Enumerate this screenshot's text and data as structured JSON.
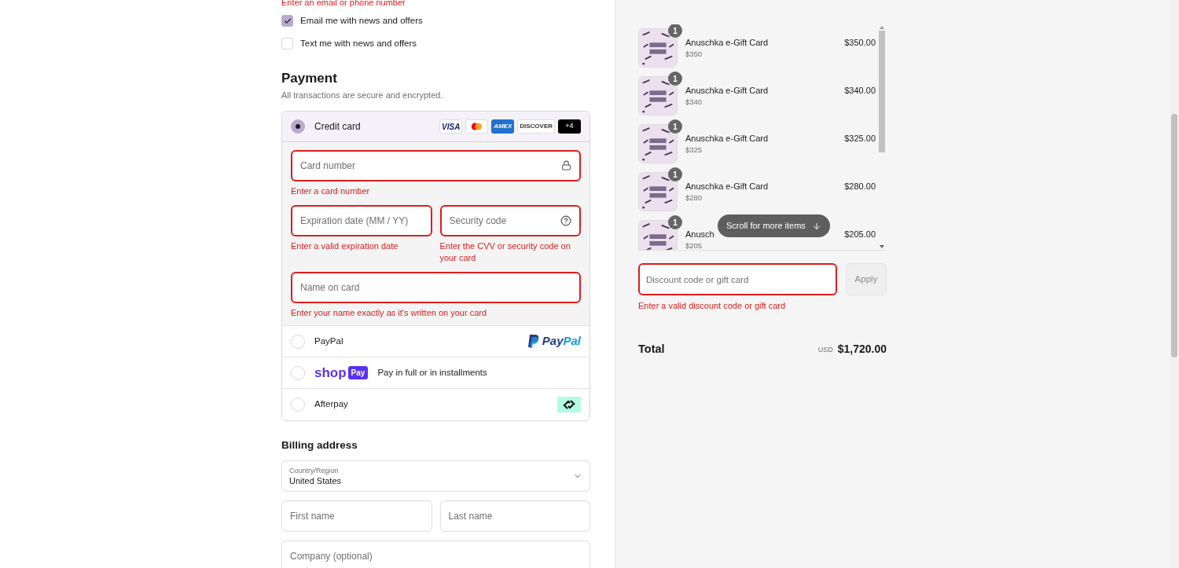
{
  "contact": {
    "error": "Enter an email or phone number",
    "options": [
      {
        "label": "Email me with news and offers",
        "checked": true
      },
      {
        "label": "Text me with news and offers",
        "checked": false
      }
    ]
  },
  "payment": {
    "title": "Payment",
    "subtitle": "All transactions are secure and encrypted.",
    "methods": [
      {
        "kind": "card",
        "label": "Credit card",
        "selected": true,
        "brands": [
          "VISA",
          "AMEX",
          "DISCOVER",
          "+4"
        ],
        "fields": [
          {
            "placeholder": "Card number",
            "error": "Enter a card number"
          },
          {
            "placeholder": "Expiration date (MM / YY)",
            "error": "Enter a valid expiration date"
          },
          {
            "placeholder": "Security code",
            "error": "Enter the CVV or security code on your card"
          },
          {
            "placeholder": "Name on card",
            "error": "Enter your name exactly as it's written on your card"
          }
        ]
      },
      {
        "kind": "paypal",
        "label": "PayPal",
        "selected": false,
        "logo": [
          "Pay",
          "Pal"
        ]
      },
      {
        "kind": "shoppay",
        "label": "Pay in full or in installments",
        "selected": false,
        "logo": [
          "shop",
          "Pay"
        ]
      },
      {
        "kind": "afterpay",
        "label": "Afterpay",
        "selected": false
      }
    ]
  },
  "billing": {
    "title": "Billing address",
    "country": {
      "label": "Country/Region",
      "value": "United States"
    },
    "fields": [
      {
        "placeholder": "First name"
      },
      {
        "placeholder": "Last name"
      },
      {
        "placeholder": "Company (optional)"
      }
    ]
  },
  "cart": {
    "items": [
      {
        "title": "Anuschka e-Gift Card",
        "variant": "$350",
        "price": "$350.00",
        "quantity": "1"
      },
      {
        "title": "Anuschka e-Gift Card",
        "variant": "$340",
        "price": "$340.00",
        "quantity": "1"
      },
      {
        "title": "Anuschka e-Gift Card",
        "variant": "$325",
        "price": "$325.00",
        "quantity": "1"
      },
      {
        "title": "Anuschka e-Gift Card",
        "variant": "$280",
        "price": "$280.00",
        "quantity": "1"
      },
      {
        "title": "Anusch",
        "variant": "$205",
        "price": "$205.00",
        "quantity": "1"
      }
    ],
    "scroll_hint": "Scroll for more items",
    "discount": {
      "placeholder": "Discount code or gift card",
      "button": "Apply",
      "error": "Enter a valid discount code or gift card"
    },
    "total": {
      "label": "Total",
      "currency": "USD",
      "amount": "$1,720.00"
    }
  }
}
